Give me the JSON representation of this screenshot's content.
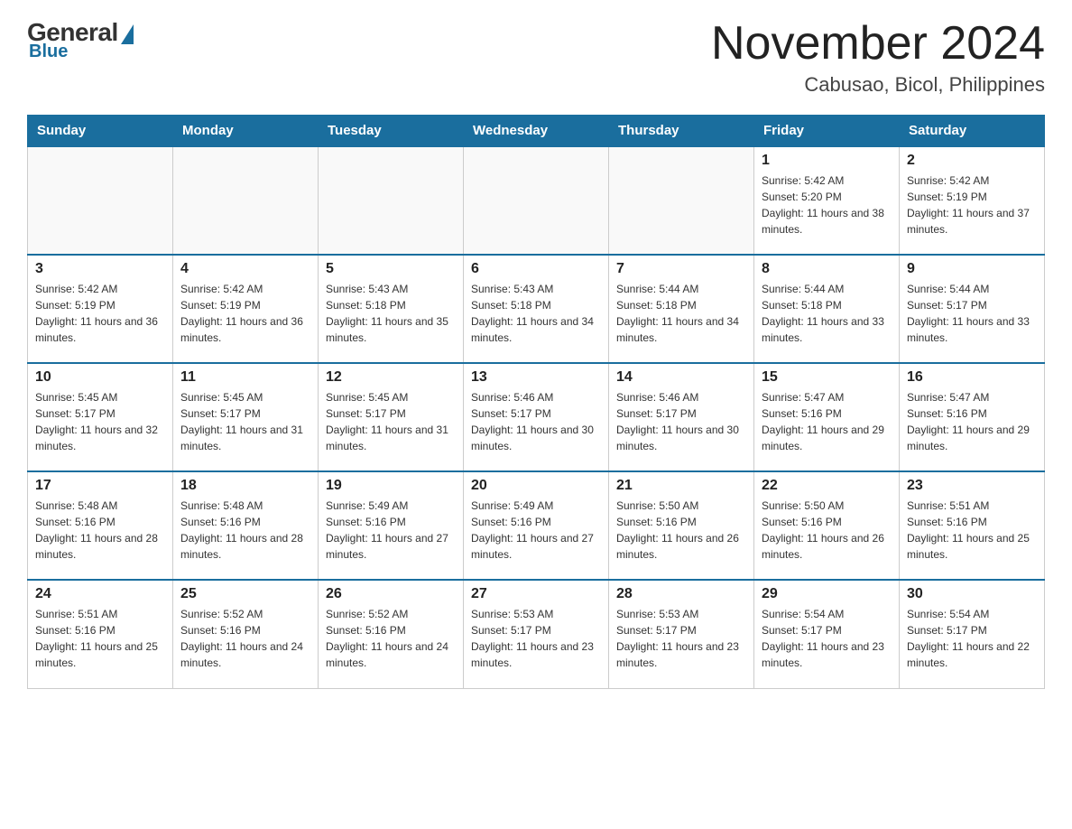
{
  "logo": {
    "general": "General",
    "blue": "Blue"
  },
  "header": {
    "month_year": "November 2024",
    "location": "Cabusao, Bicol, Philippines"
  },
  "days_of_week": [
    "Sunday",
    "Monday",
    "Tuesday",
    "Wednesday",
    "Thursday",
    "Friday",
    "Saturday"
  ],
  "weeks": [
    {
      "days": [
        {
          "date": "",
          "info": ""
        },
        {
          "date": "",
          "info": ""
        },
        {
          "date": "",
          "info": ""
        },
        {
          "date": "",
          "info": ""
        },
        {
          "date": "",
          "info": ""
        },
        {
          "date": "1",
          "sunrise": "5:42 AM",
          "sunset": "5:20 PM",
          "daylight": "11 hours and 38 minutes."
        },
        {
          "date": "2",
          "sunrise": "5:42 AM",
          "sunset": "5:19 PM",
          "daylight": "11 hours and 37 minutes."
        }
      ]
    },
    {
      "days": [
        {
          "date": "3",
          "sunrise": "5:42 AM",
          "sunset": "5:19 PM",
          "daylight": "11 hours and 36 minutes."
        },
        {
          "date": "4",
          "sunrise": "5:42 AM",
          "sunset": "5:19 PM",
          "daylight": "11 hours and 36 minutes."
        },
        {
          "date": "5",
          "sunrise": "5:43 AM",
          "sunset": "5:18 PM",
          "daylight": "11 hours and 35 minutes."
        },
        {
          "date": "6",
          "sunrise": "5:43 AM",
          "sunset": "5:18 PM",
          "daylight": "11 hours and 34 minutes."
        },
        {
          "date": "7",
          "sunrise": "5:44 AM",
          "sunset": "5:18 PM",
          "daylight": "11 hours and 34 minutes."
        },
        {
          "date": "8",
          "sunrise": "5:44 AM",
          "sunset": "5:18 PM",
          "daylight": "11 hours and 33 minutes."
        },
        {
          "date": "9",
          "sunrise": "5:44 AM",
          "sunset": "5:17 PM",
          "daylight": "11 hours and 33 minutes."
        }
      ]
    },
    {
      "days": [
        {
          "date": "10",
          "sunrise": "5:45 AM",
          "sunset": "5:17 PM",
          "daylight": "11 hours and 32 minutes."
        },
        {
          "date": "11",
          "sunrise": "5:45 AM",
          "sunset": "5:17 PM",
          "daylight": "11 hours and 31 minutes."
        },
        {
          "date": "12",
          "sunrise": "5:45 AM",
          "sunset": "5:17 PM",
          "daylight": "11 hours and 31 minutes."
        },
        {
          "date": "13",
          "sunrise": "5:46 AM",
          "sunset": "5:17 PM",
          "daylight": "11 hours and 30 minutes."
        },
        {
          "date": "14",
          "sunrise": "5:46 AM",
          "sunset": "5:17 PM",
          "daylight": "11 hours and 30 minutes."
        },
        {
          "date": "15",
          "sunrise": "5:47 AM",
          "sunset": "5:16 PM",
          "daylight": "11 hours and 29 minutes."
        },
        {
          "date": "16",
          "sunrise": "5:47 AM",
          "sunset": "5:16 PM",
          "daylight": "11 hours and 29 minutes."
        }
      ]
    },
    {
      "days": [
        {
          "date": "17",
          "sunrise": "5:48 AM",
          "sunset": "5:16 PM",
          "daylight": "11 hours and 28 minutes."
        },
        {
          "date": "18",
          "sunrise": "5:48 AM",
          "sunset": "5:16 PM",
          "daylight": "11 hours and 28 minutes."
        },
        {
          "date": "19",
          "sunrise": "5:49 AM",
          "sunset": "5:16 PM",
          "daylight": "11 hours and 27 minutes."
        },
        {
          "date": "20",
          "sunrise": "5:49 AM",
          "sunset": "5:16 PM",
          "daylight": "11 hours and 27 minutes."
        },
        {
          "date": "21",
          "sunrise": "5:50 AM",
          "sunset": "5:16 PM",
          "daylight": "11 hours and 26 minutes."
        },
        {
          "date": "22",
          "sunrise": "5:50 AM",
          "sunset": "5:16 PM",
          "daylight": "11 hours and 26 minutes."
        },
        {
          "date": "23",
          "sunrise": "5:51 AM",
          "sunset": "5:16 PM",
          "daylight": "11 hours and 25 minutes."
        }
      ]
    },
    {
      "days": [
        {
          "date": "24",
          "sunrise": "5:51 AM",
          "sunset": "5:16 PM",
          "daylight": "11 hours and 25 minutes."
        },
        {
          "date": "25",
          "sunrise": "5:52 AM",
          "sunset": "5:16 PM",
          "daylight": "11 hours and 24 minutes."
        },
        {
          "date": "26",
          "sunrise": "5:52 AM",
          "sunset": "5:16 PM",
          "daylight": "11 hours and 24 minutes."
        },
        {
          "date": "27",
          "sunrise": "5:53 AM",
          "sunset": "5:17 PM",
          "daylight": "11 hours and 23 minutes."
        },
        {
          "date": "28",
          "sunrise": "5:53 AM",
          "sunset": "5:17 PM",
          "daylight": "11 hours and 23 minutes."
        },
        {
          "date": "29",
          "sunrise": "5:54 AM",
          "sunset": "5:17 PM",
          "daylight": "11 hours and 23 minutes."
        },
        {
          "date": "30",
          "sunrise": "5:54 AM",
          "sunset": "5:17 PM",
          "daylight": "11 hours and 22 minutes."
        }
      ]
    }
  ]
}
